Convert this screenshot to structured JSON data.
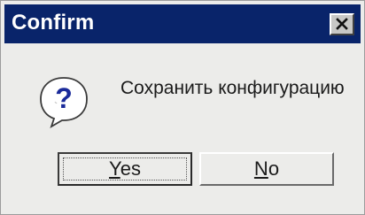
{
  "window": {
    "title": "Confirm",
    "close_glyph": "close-icon"
  },
  "dialog": {
    "icon": "question-icon",
    "message": "Сохранить конфигурацию"
  },
  "buttons": {
    "yes": {
      "mnemonic": "Y",
      "rest": "es"
    },
    "no": {
      "mnemonic": "N",
      "rest": "o"
    }
  },
  "colors": {
    "titlebar": "#09246a",
    "dialog_bg": "#ececea",
    "icon_bubble": "#ffffff",
    "icon_glyph": "#1a2a9a"
  }
}
